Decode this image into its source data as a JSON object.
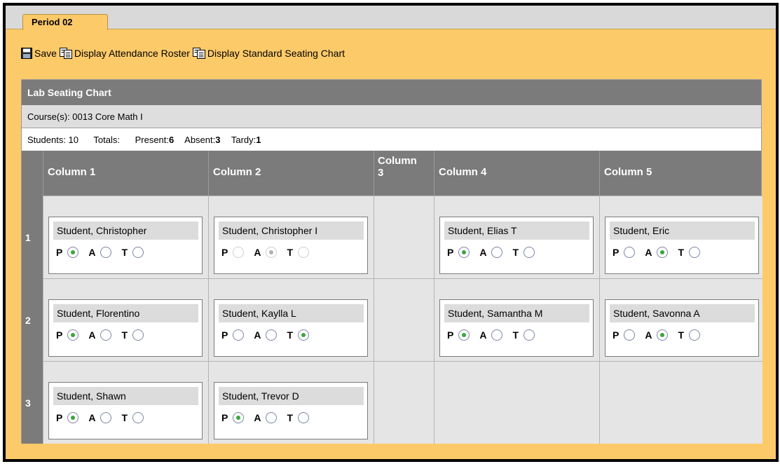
{
  "tab": {
    "label": "Period 02"
  },
  "toolbar": {
    "save_label": "Save",
    "attendance_roster_label": "Display Attendance Roster",
    "standard_seating_label": "Display Standard Seating Chart"
  },
  "panel": {
    "title": "Lab Seating Chart",
    "course": "Course(s): 0013 Core Math I",
    "students_label": "Students: 10",
    "totals_label": "Totals:",
    "present_label": "Present:",
    "present_value": "6",
    "absent_label": "Absent:",
    "absent_value": "3",
    "tardy_label": "Tardy:",
    "tardy_value": "1"
  },
  "columns": [
    {
      "label": "Column 1"
    },
    {
      "label": "Column 2"
    },
    {
      "label": "Column\n3"
    },
    {
      "label": "Column 4"
    },
    {
      "label": "Column 5"
    }
  ],
  "rows": [
    {
      "label": "1"
    },
    {
      "label": "2"
    },
    {
      "label": "3"
    }
  ],
  "option_labels": {
    "present": "P",
    "absent": "A",
    "tardy": "T"
  },
  "students": [
    {
      "name": "Student, Christopher",
      "status": "P",
      "disabled": false
    },
    {
      "name": "Student, Christopher I",
      "status": "A",
      "disabled": true
    },
    {
      "name": "Student, Elias T",
      "status": "P",
      "disabled": false
    },
    {
      "name": "Student, Eric",
      "status": "A",
      "disabled": false
    },
    {
      "name": "Student, Florentino",
      "status": "P",
      "disabled": false
    },
    {
      "name": "Student, Kaylla L",
      "status": "T",
      "disabled": false
    },
    {
      "name": "Student, Samantha M",
      "status": "P",
      "disabled": false
    },
    {
      "name": "Student, Savonna A",
      "status": "A",
      "disabled": false
    },
    {
      "name": "Student, Shawn",
      "status": "P",
      "disabled": false
    },
    {
      "name": "Student, Trevor D",
      "status": "P",
      "disabled": false
    }
  ]
}
